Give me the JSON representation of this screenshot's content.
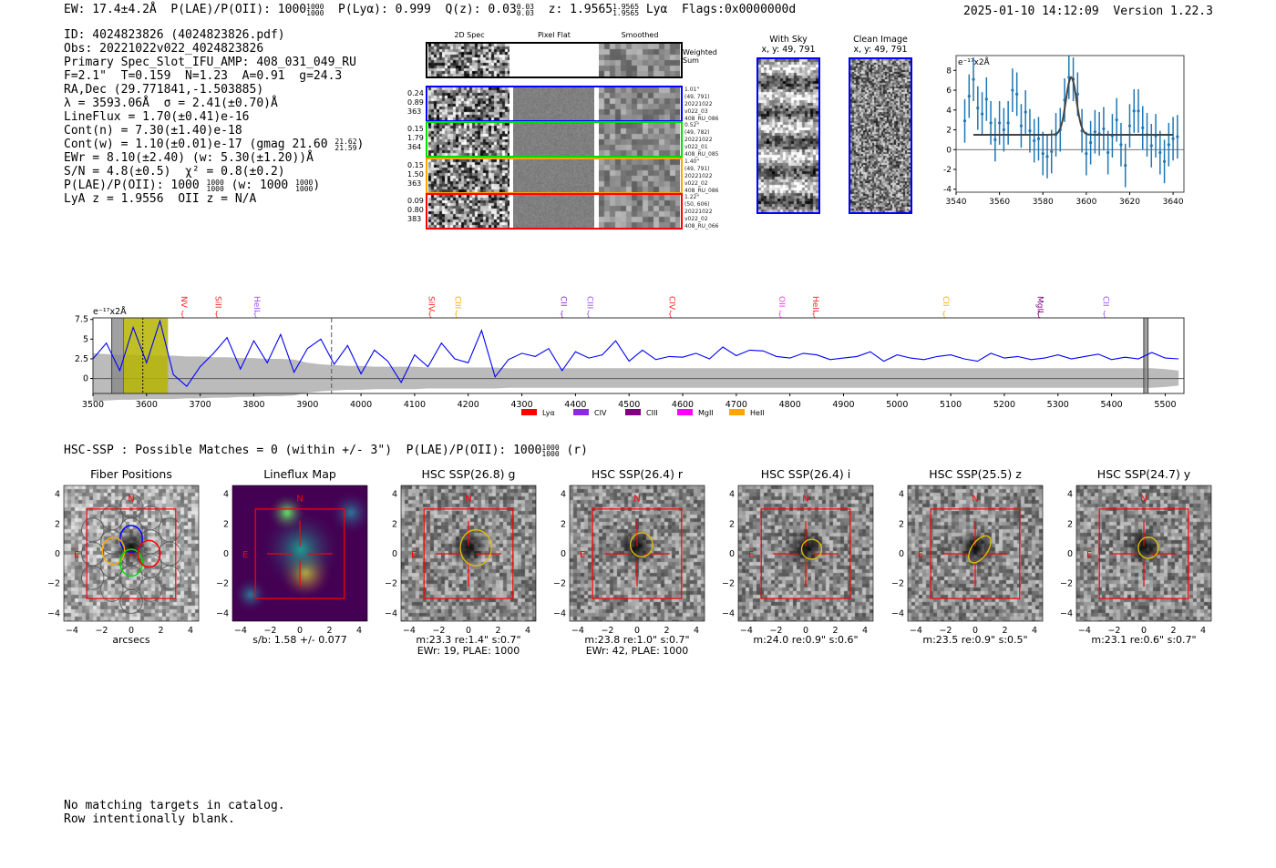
{
  "header": {
    "ew": "EW: 17.4±4.2Å",
    "plae": "P(LAE)/P(OII): 1000",
    "plae_hi": "1000",
    "plae_lo": "1000",
    "plya": "P(Lyα): 0.999",
    "qz": "Q(z): 0.03",
    "qz_hi": "0.03",
    "qz_lo": "0.03",
    "z": "z: 1.9565",
    "z_hi": "1.9565",
    "z_lo": "1.9565",
    "z_line": "Lyα",
    "flags": "Flags:0x0000000d",
    "timestamp": "2025-01-10 14:12:09",
    "version": "Version 1.22.3"
  },
  "info": [
    "ID: 4024823826 (4024823826.pdf)",
    "Obs: 20221022v022_4024823826",
    "Primary Spec_Slot_IFU_AMP: 408_031_049_RU",
    "F=2.1\"  T=0.159  N=1.23  A=0.91  g=24.3",
    "RA,Dec (29.771841,-1.503885)",
    "λ = 3593.06Å  σ = 2.41(±0.70)Å",
    "LineFlux = 1.70(±0.41)e-16",
    "Cont(n) = 7.30(±1.40)e-18",
    "Cont(w) = 1.10(±0.01)e-17 (gmag 21.60",
    "EWr = 8.10(±2.40) (w: 5.30(±1.20))Å",
    "S/N = 4.8(±0.5)  χ² = 0.8(±0.2)",
    "P(LAE)/P(OII): 1000",
    "LyA z = 1.9556  OII z = N/A"
  ],
  "info_extra": {
    "gmag_hi": "21.62",
    "gmag_lo": "21.59",
    "gmag_close": ")",
    "plae_hi": "1000",
    "plae_lo": "1000",
    "plae_w": "(w: 1000",
    "plae_w_hi": "1000",
    "plae_w_lo": "1000",
    "plae_w_close": ")"
  },
  "spec2d": {
    "columns": [
      "2D Spec",
      "Pixel Flat",
      "Smoothed"
    ],
    "weighted_label": "Weighted\nSum",
    "rows": [
      {
        "color": "#0000ff",
        "left": "0.24\n0.89\n363",
        "right": "1.01\"\n(49, 791)\n20221022\nv022_03\n408_RU_086"
      },
      {
        "color": "#00dd00",
        "left": "0.15\n1.79\n364",
        "right": "0.52\"\n(49, 782)\n20221022\nv022_01\n408_RU_085"
      },
      {
        "color": "#ffa500",
        "left": "0.15\n1.50\n363",
        "right": "1.40\"\n(49, 791)\n20221022\nv022_02\n408_RU_086"
      },
      {
        "color": "#ff0000",
        "left": "0.09\n0.80\n383",
        "right": "1.22\"\n(50, 606)\n20221022\nv022_02\n408_RU_066"
      }
    ]
  },
  "sky": {
    "with_sky_title": "With Sky\nx, y: 49, 791",
    "clean_title": "Clean Image\nx, y: 49, 791"
  },
  "chart_data": [
    {
      "type": "scatter",
      "ylabel": "e⁻¹⁷x2Å",
      "xlim": [
        3540,
        3645
      ],
      "ylim": [
        -4.3,
        9.5
      ],
      "xticks": [
        3540,
        3560,
        3580,
        3600,
        3620,
        3640
      ],
      "yticks": [
        -4,
        -2,
        0,
        2,
        4,
        6,
        8
      ],
      "x": [
        3544,
        3546,
        3548,
        3550,
        3552,
        3554,
        3556,
        3558,
        3560,
        3562,
        3564,
        3566,
        3568,
        3570,
        3572,
        3574,
        3576,
        3578,
        3580,
        3582,
        3584,
        3586,
        3588,
        3590,
        3592,
        3594,
        3596,
        3598,
        3600,
        3602,
        3604,
        3606,
        3608,
        3610,
        3612,
        3614,
        3616,
        3618,
        3620,
        3622,
        3624,
        3626,
        3628,
        3630,
        3632,
        3634,
        3636,
        3638,
        3640,
        3642
      ],
      "y": [
        2.9,
        5.4,
        7.1,
        4.2,
        3.6,
        5.1,
        2.7,
        1.0,
        2.7,
        2.0,
        2.7,
        6.0,
        5.6,
        2.4,
        3.8,
        1.9,
        0.9,
        1.1,
        -0.4,
        -0.7,
        -0.2,
        1.5,
        2.0,
        5.0,
        7.3,
        7.1,
        5.6,
        1.9,
        -0.4,
        0.7,
        1.8,
        1.6,
        2.1,
        -0.3,
        1.4,
        3.0,
        0.5,
        -1.6,
        2.4,
        3.9,
        3.9,
        2.2,
        1.5,
        0.4,
        1.4,
        -0.3,
        -1.2,
        0.5,
        1.1,
        1.3
      ],
      "yerr": 2.2,
      "fit": {
        "center": 3593.06,
        "sigma": 2.41,
        "continuum": 1.5,
        "amplitude": 5.8,
        "range": [
          3548,
          3640
        ]
      }
    },
    {
      "type": "line",
      "ylabel": "e⁻¹⁷x2Å",
      "xlim": [
        3500,
        5535
      ],
      "ylim": [
        -1.9,
        7.7
      ],
      "xticks": [
        3500,
        3600,
        3700,
        3800,
        3900,
        4000,
        4100,
        4200,
        4300,
        4400,
        4500,
        4600,
        4700,
        4800,
        4900,
        5000,
        5100,
        5200,
        5300,
        5400,
        5500
      ],
      "yticks": [
        0.0,
        2.5,
        5.0,
        7.5
      ],
      "x_start": 3500,
      "x_step": 25,
      "y": [
        2.5,
        4.5,
        1.0,
        6.5,
        2.0,
        7.3,
        0.5,
        -1.0,
        1.5,
        3.2,
        5.2,
        1.2,
        4.8,
        2.0,
        5.6,
        0.8,
        3.8,
        5.0,
        1.8,
        4.2,
        0.6,
        3.6,
        2.2,
        -0.5,
        3.0,
        1.5,
        4.5,
        2.5,
        2.0,
        6.1,
        0.2,
        2.4,
        3.2,
        2.8,
        3.8,
        1.0,
        3.4,
        2.6,
        3.0,
        4.8,
        2.2,
        3.6,
        2.4,
        2.8,
        2.7,
        3.2,
        2.5,
        4.0,
        2.9,
        3.6,
        3.5,
        2.8,
        2.6,
        3.2,
        3.0,
        2.4,
        2.6,
        2.8,
        3.4,
        2.2,
        3.0,
        2.6,
        2.4,
        2.8,
        3.0,
        2.5,
        2.2,
        3.2,
        2.6,
        2.8,
        2.4,
        2.6,
        3.0,
        2.5,
        2.8,
        3.1,
        2.4,
        2.7,
        2.5,
        3.3,
        2.6,
        2.5
      ],
      "err": [
        3.2,
        3.1,
        3.0,
        3.0,
        2.9,
        2.9,
        2.9,
        2.8,
        2.8,
        2.7,
        2.7,
        2.6,
        2.6,
        2.5,
        2.5,
        2.4,
        2.0,
        1.8,
        1.7,
        1.6,
        1.6,
        1.5,
        1.5,
        1.5,
        1.5,
        1.4,
        1.4,
        1.4,
        1.4,
        1.4,
        1.4,
        1.3,
        1.3,
        1.3,
        1.3,
        1.3,
        1.3,
        1.3,
        1.3,
        1.3,
        1.3,
        1.3,
        1.3,
        1.3,
        1.3,
        1.3,
        1.3,
        1.3,
        1.3,
        1.3,
        1.3,
        1.3,
        1.3,
        1.3,
        1.3,
        1.3,
        1.3,
        1.3,
        1.3,
        1.3,
        1.3,
        1.3,
        1.3,
        1.3,
        1.3,
        1.3,
        1.3,
        1.3,
        1.3,
        1.3,
        1.3,
        1.3,
        1.3,
        1.3,
        1.3,
        1.3,
        1.3,
        1.3,
        1.3,
        1.3,
        1.2,
        1.0
      ],
      "shaded_gray": [
        [
          3535,
          3557
        ],
        [
          5460,
          5468
        ]
      ],
      "shaded_yellow": [
        3557,
        3640
      ],
      "vline_dotted": 3593,
      "vline_dashed": 3945,
      "lines": [
        {
          "label": "NV",
          "wave": 3670,
          "color": "#ff2222"
        },
        {
          "label": "SiII",
          "wave": 3734,
          "color": "#ff2222"
        },
        {
          "label": "HeII",
          "wave": 3806,
          "color": "#9b4dff"
        },
        {
          "label": "SiIV",
          "wave": 4132,
          "color": "#ff2222"
        },
        {
          "label": "CIII",
          "wave": 4181,
          "color": "#ffaa00"
        },
        {
          "label": "CII",
          "wave": 4378,
          "color": "#8a2be2"
        },
        {
          "label": "CIII",
          "wave": 4427,
          "color": "#9b4dff"
        },
        {
          "label": "CIV",
          "wave": 4580,
          "color": "#ff2222"
        },
        {
          "label": "OII",
          "wave": 4785,
          "color": "#ff33ff"
        },
        {
          "label": "HeII",
          "wave": 4848,
          "color": "#ff2222"
        },
        {
          "label": "CII",
          "wave": 5091,
          "color": "#ffaa00"
        },
        {
          "label": "MgII",
          "wave": 5267,
          "color": "#800080"
        },
        {
          "label": "CII",
          "wave": 5390,
          "color": "#9b4dff"
        }
      ],
      "legend": [
        {
          "label": "Lyα",
          "color": "#ff0000"
        },
        {
          "label": "CIV",
          "color": "#8a2be2"
        },
        {
          "label": "CIII",
          "color": "#800080"
        },
        {
          "label": "MgII",
          "color": "#ff00ff"
        },
        {
          "label": "HeII",
          "color": "#ffa500"
        }
      ]
    }
  ],
  "hsc": {
    "summary": "HSC-SSP : Possible Matches = 0 (within +/- 3\")  P(LAE)/P(OII): 1000",
    "sum_hi": "1000",
    "sum_lo": "1000",
    "sum_band": "(r)",
    "ticks": [
      "−4",
      "−2",
      "0",
      "2",
      "4"
    ],
    "north": "N",
    "east": "E",
    "panels": [
      {
        "title": "Fiber Positions",
        "cap1": "arcsecs",
        "cap2": ""
      },
      {
        "title": "Lineflux Map",
        "cap1": "s/b: 1.58 +/- 0.077",
        "cap2": ""
      },
      {
        "title": "HSC SSP(26.8) g",
        "cap1": "m:23.3  re:1.4\"  s:0.7\"",
        "cap2": "EWr: 19, PLAE: 1000"
      },
      {
        "title": "HSC SSP(26.4) r",
        "cap1": "m:23.8  re:1.0\"  s:0.7\"",
        "cap2": "EWr: 42, PLAE: 1000"
      },
      {
        "title": "HSC SSP(26.4) i",
        "cap1": "m:24.0  re:0.9\"  s:0.6\"",
        "cap2": ""
      },
      {
        "title": "HSC SSP(25.5) z",
        "cap1": "m:23.5  re:0.9\"  s:0.5\"",
        "cap2": ""
      },
      {
        "title": "HSC SSP(24.7) y",
        "cap1": "m:23.1  re:0.6\"  s:0.7\"",
        "cap2": ""
      }
    ]
  },
  "footer": [
    "No matching targets in catalog.",
    "Row intentionally blank."
  ]
}
